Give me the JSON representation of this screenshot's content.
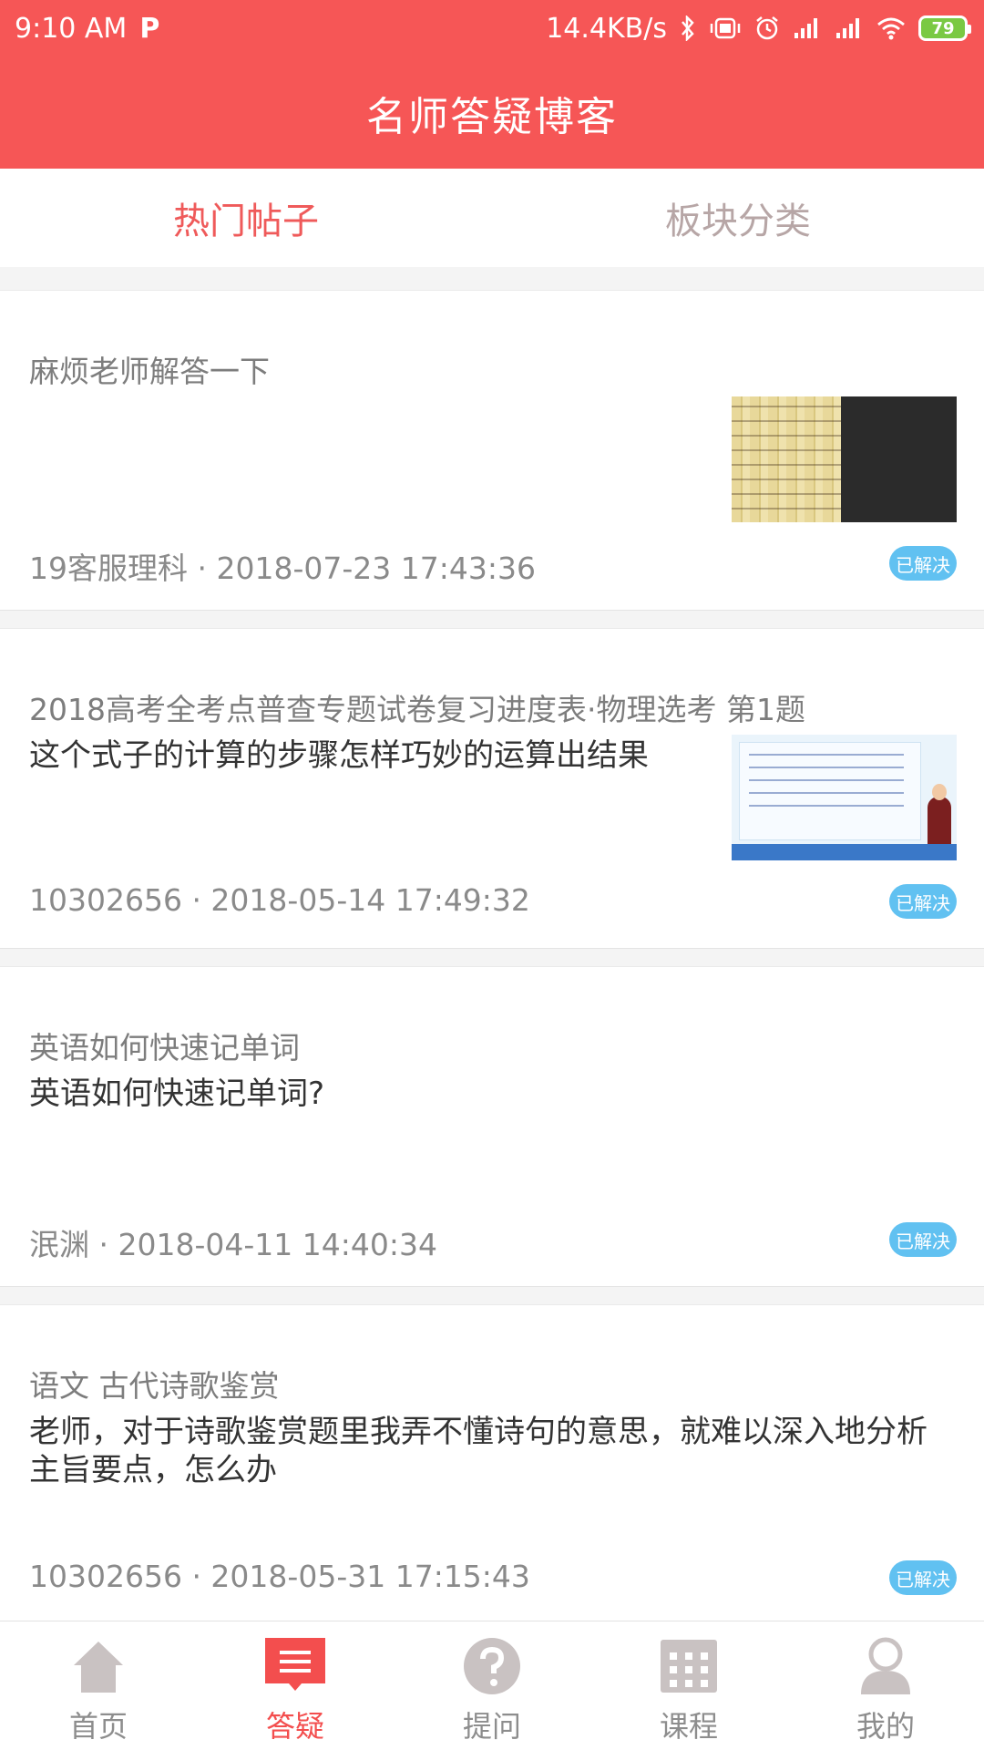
{
  "status_bar": {
    "time": "9:10 AM",
    "p_icon": "P",
    "speed": "14.4KB/s",
    "battery_level": "79"
  },
  "header": {
    "title": "名师答疑博客"
  },
  "tabs": [
    {
      "label": "热门帖子",
      "active": true
    },
    {
      "label": "板块分类",
      "active": false
    }
  ],
  "posts": [
    {
      "title": "麻烦老师解答一下",
      "body": "",
      "meta": "19客服理科 · 2018-07-23 17:43:36",
      "badge": "已解决"
    },
    {
      "title": "2018高考全考点普查专题试卷复习进度表·物理选考  第1题",
      "body": "这个式子的计算的步骤怎样巧妙的运算出结果",
      "meta": "10302656 · 2018-05-14 17:49:32",
      "badge": "已解决"
    },
    {
      "title": "英语如何快速记单词",
      "body": "英语如何快速记单词?",
      "meta": "泯渊 · 2018-04-11 14:40:34",
      "badge": "已解决"
    },
    {
      "title": "语文 古代诗歌鉴赏",
      "body": "老师，对于诗歌鉴赏题里我弄不懂诗句的意思，就难以深入地分析主旨要点，怎么办",
      "meta": "10302656 · 2018-05-31 17:15:43",
      "badge": "已解决"
    }
  ],
  "nav": [
    {
      "label": "首页",
      "icon": "home-icon",
      "active": false
    },
    {
      "label": "答疑",
      "icon": "qa-list-icon",
      "active": true
    },
    {
      "label": "提问",
      "icon": "question-icon",
      "active": false
    },
    {
      "label": "课程",
      "icon": "calendar-icon",
      "active": false
    },
    {
      "label": "我的",
      "icon": "profile-icon",
      "active": false
    }
  ],
  "colors": {
    "brand": "#f65656",
    "active_tab": "#ef5a5a",
    "badge": "#61c1f1",
    "nav_active": "#f34e4e",
    "nav_inactive_icon": "#c9c2c2"
  }
}
